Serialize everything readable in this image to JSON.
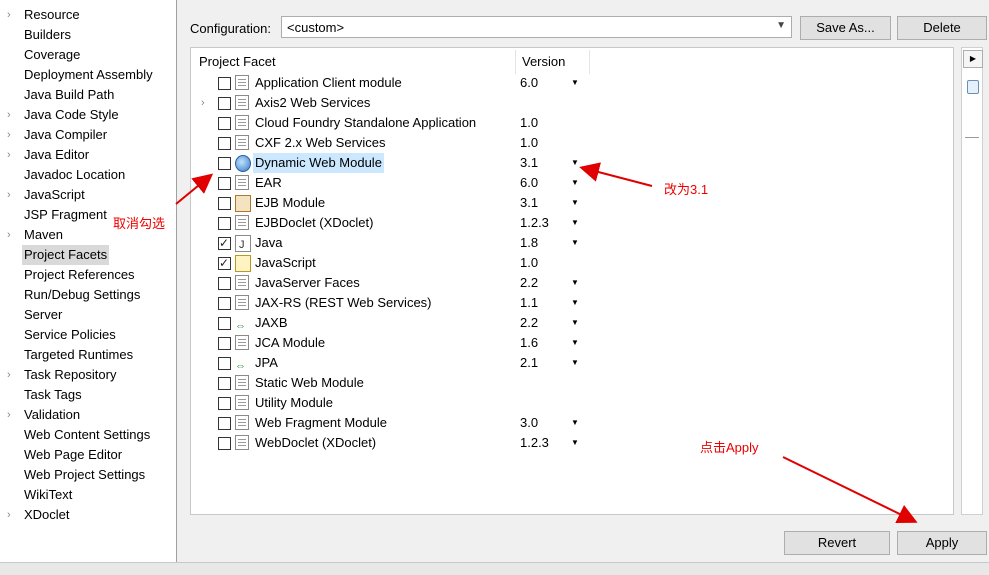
{
  "sidebar": {
    "items": [
      {
        "label": "Resource",
        "expandable": true
      },
      {
        "label": "Builders",
        "expandable": false
      },
      {
        "label": "Coverage",
        "expandable": false
      },
      {
        "label": "Deployment Assembly",
        "expandable": false
      },
      {
        "label": "Java Build Path",
        "expandable": false
      },
      {
        "label": "Java Code Style",
        "expandable": true
      },
      {
        "label": "Java Compiler",
        "expandable": true
      },
      {
        "label": "Java Editor",
        "expandable": true
      },
      {
        "label": "Javadoc Location",
        "expandable": false
      },
      {
        "label": "JavaScript",
        "expandable": true
      },
      {
        "label": "JSP Fragment",
        "expandable": false
      },
      {
        "label": "Maven",
        "expandable": true
      },
      {
        "label": "Project Facets",
        "expandable": false,
        "selected": true
      },
      {
        "label": "Project References",
        "expandable": false
      },
      {
        "label": "Run/Debug Settings",
        "expandable": false
      },
      {
        "label": "Server",
        "expandable": false
      },
      {
        "label": "Service Policies",
        "expandable": false
      },
      {
        "label": "Targeted Runtimes",
        "expandable": false
      },
      {
        "label": "Task Repository",
        "expandable": true
      },
      {
        "label": "Task Tags",
        "expandable": false
      },
      {
        "label": "Validation",
        "expandable": true
      },
      {
        "label": "Web Content Settings",
        "expandable": false
      },
      {
        "label": "Web Page Editor",
        "expandable": false
      },
      {
        "label": "Web Project Settings",
        "expandable": false
      },
      {
        "label": "WikiText",
        "expandable": false
      },
      {
        "label": "XDoclet",
        "expandable": true
      }
    ]
  },
  "config": {
    "label": "Configuration:",
    "value": "<custom>",
    "save_as": "Save As...",
    "delete": "Delete"
  },
  "table": {
    "headers": {
      "facet": "Project Facet",
      "version": "Version"
    },
    "rows": [
      {
        "name": "Application Client module",
        "version": "6.0",
        "checked": false,
        "dropdown": true,
        "icon": "doc-icon"
      },
      {
        "name": "Axis2 Web Services",
        "version": "",
        "checked": false,
        "dropdown": false,
        "icon": "doc-icon",
        "expandable": true
      },
      {
        "name": "Cloud Foundry Standalone Application",
        "version": "1.0",
        "checked": false,
        "dropdown": false,
        "icon": "doc-icon"
      },
      {
        "name": "CXF 2.x Web Services",
        "version": "1.0",
        "checked": false,
        "dropdown": false,
        "icon": "doc-icon"
      },
      {
        "name": "Dynamic Web Module",
        "version": "3.1",
        "checked": false,
        "dropdown": true,
        "icon": "globe-icon",
        "highlight": true
      },
      {
        "name": "EAR",
        "version": "6.0",
        "checked": false,
        "dropdown": true,
        "icon": "doc-icon"
      },
      {
        "name": "EJB Module",
        "version": "3.1",
        "checked": false,
        "dropdown": true,
        "icon": "ejb-icon"
      },
      {
        "name": "EJBDoclet (XDoclet)",
        "version": "1.2.3",
        "checked": false,
        "dropdown": true,
        "icon": "doc-icon"
      },
      {
        "name": "Java",
        "version": "1.8",
        "checked": true,
        "dropdown": true,
        "icon": "java-icon"
      },
      {
        "name": "JavaScript",
        "version": "1.0",
        "checked": true,
        "dropdown": false,
        "icon": "js-icon"
      },
      {
        "name": "JavaServer Faces",
        "version": "2.2",
        "checked": false,
        "dropdown": true,
        "icon": "doc-icon"
      },
      {
        "name": "JAX-RS (REST Web Services)",
        "version": "1.1",
        "checked": false,
        "dropdown": true,
        "icon": "doc-icon"
      },
      {
        "name": "JAXB",
        "version": "2.2",
        "checked": false,
        "dropdown": true,
        "icon": "jaxb-icon"
      },
      {
        "name": "JCA Module",
        "version": "1.6",
        "checked": false,
        "dropdown": true,
        "icon": "doc-icon"
      },
      {
        "name": "JPA",
        "version": "2.1",
        "checked": false,
        "dropdown": true,
        "icon": "jpa-icon"
      },
      {
        "name": "Static Web Module",
        "version": "",
        "checked": false,
        "dropdown": false,
        "icon": "doc-icon"
      },
      {
        "name": "Utility Module",
        "version": "",
        "checked": false,
        "dropdown": false,
        "icon": "doc-icon"
      },
      {
        "name": "Web Fragment Module",
        "version": "3.0",
        "checked": false,
        "dropdown": true,
        "icon": "doc-icon"
      },
      {
        "name": "WebDoclet (XDoclet)",
        "version": "1.2.3",
        "checked": false,
        "dropdown": true,
        "icon": "doc-icon"
      }
    ]
  },
  "buttons": {
    "revert": "Revert",
    "apply": "Apply"
  },
  "annotations": {
    "uncheck": "取消勾选",
    "change_to": "改为3.1",
    "click_apply": "点击Apply",
    "color": "#e00000"
  }
}
